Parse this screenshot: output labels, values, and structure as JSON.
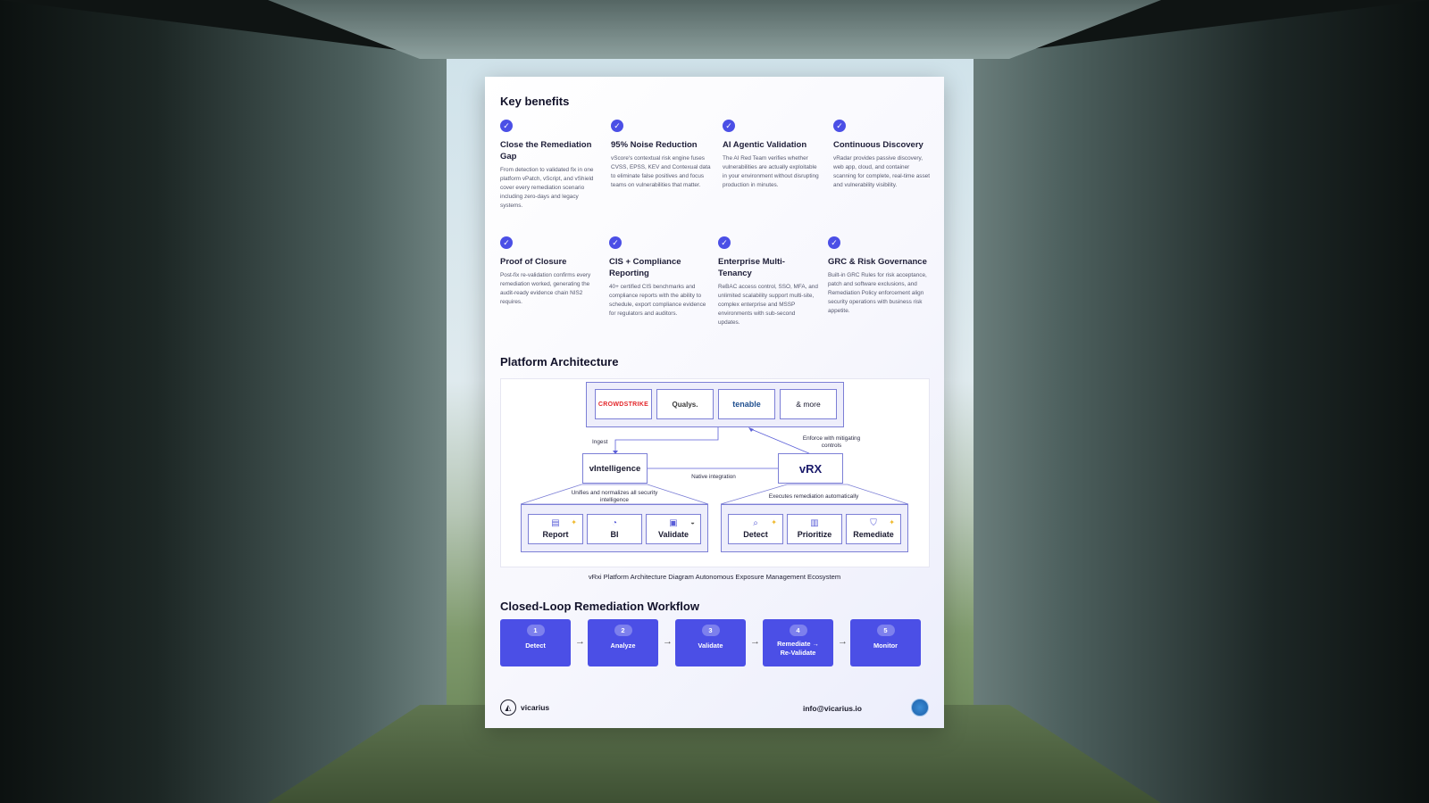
{
  "section_key_benefits": "Key benefits",
  "benefits": [
    {
      "title": "Close the Remediation Gap",
      "desc": "From detection to validated fix in one platform vPatch, vScript, and vShield cover every remediation scenario including zero-days and legacy systems."
    },
    {
      "title": "95% Noise Reduction",
      "desc": "vScore's contextual risk engine fuses CVSS, EPSS, KEV and Contexual data to eliminate false positives and focus teams on vulnerabilities that matter."
    },
    {
      "title": "AI Agentic Validation",
      "desc": "The AI Red Team verifies whether vulnerabilities are actually exploitable in your environment without disrupting production in minutes."
    },
    {
      "title": "Continuous Discovery",
      "desc": "vRadar provides passive discovery, web app, cloud, and container scanning for complete, real-time asset and vulnerability visibility."
    },
    {
      "title": "Proof of Closure",
      "desc": "Post-fix re-validation confirms every remediation worked, generating the audit-ready evidence chain NIS2 requires."
    },
    {
      "title": "CIS + Compliance Reporting",
      "desc": "40+ certified CIS benchmarks and compliance reports with the ability to schedule, export compliance evidence for regulators and auditors."
    },
    {
      "title": "Enterprise Multi-Tenancy",
      "desc": "ReBAC access control, SSO, MFA, and unlimited scalability support multi-site, complex enterprise and MSSP environments with sub-second updates."
    },
    {
      "title": "GRC & Risk Governance",
      "desc": "Built-in GRC Rules for risk acceptance, patch and software exclusions, and Remediation Policy enforcement align security operations with business risk appetite."
    }
  ],
  "section_architecture": "Platform Architecture",
  "arch": {
    "sources": [
      "CROWDSTRIKE",
      "Qualys.",
      "tenable",
      "& more"
    ],
    "ingest": "Ingest",
    "enforce": "Enforce with mitigating controls",
    "vintelligence": "vIntelligence",
    "vrx": "vRX",
    "native": "Native integration",
    "left_note": "Unifies and normalizes all security intelligence",
    "right_note": "Executes remediation automatically",
    "left_tiles": [
      "Report",
      "BI",
      "Validate"
    ],
    "right_tiles": [
      "Detect",
      "Prioritize",
      "Remediate"
    ],
    "caption": "vRxi Platform Architecture Diagram Autonomous Exposure Management Ecosystem"
  },
  "section_workflow": "Closed-Loop Remediation Workflow",
  "workflow": [
    {
      "num": "1",
      "label": "Detect"
    },
    {
      "num": "2",
      "label": "Analyze"
    },
    {
      "num": "3",
      "label": "Validate"
    },
    {
      "num": "4",
      "label": "Remediate → Re-Validate"
    },
    {
      "num": "5",
      "label": "Monitor"
    }
  ],
  "footer": {
    "brand": "vicarius",
    "email": "info@vicarius.io"
  },
  "colors": {
    "accent": "#4b4fe6",
    "outline": "#7c7fd6",
    "crowdstrike": "#e3262a",
    "qualys": "#d32f2f",
    "tenable": "#1f4f8f"
  }
}
